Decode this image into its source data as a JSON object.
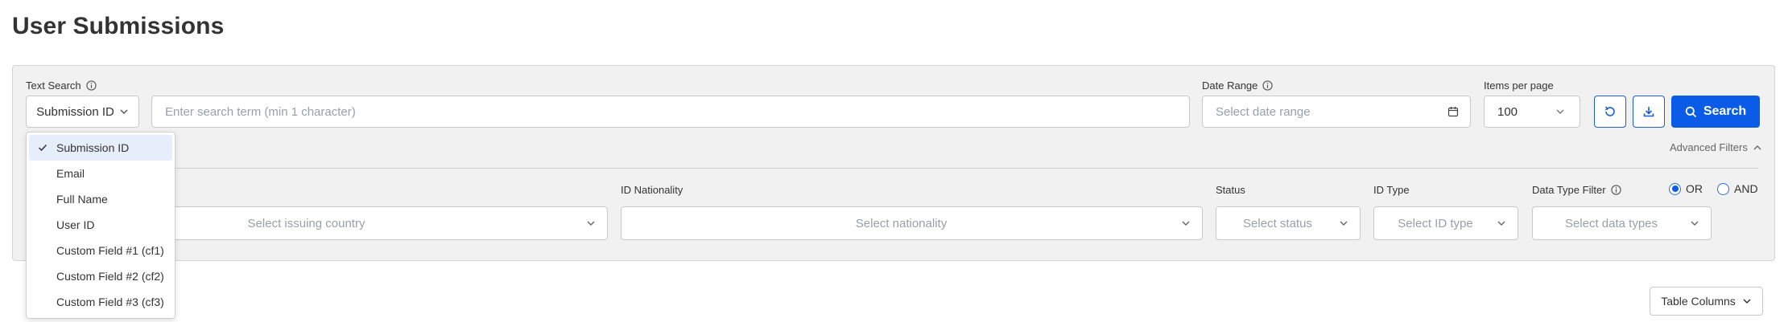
{
  "page": {
    "title": "User Submissions"
  },
  "filters": {
    "text_search_label": "Text Search",
    "search_type_value": "Submission ID",
    "search_placeholder": "Enter search term (min 1 character)",
    "date_range_label": "Date Range",
    "date_range_placeholder": "Select date range",
    "items_per_page_label": "Items per page",
    "items_per_page_value": "100",
    "search_button_label": "Search",
    "advanced_filters_label": "Advanced Filters",
    "issuing_country_placeholder": "Select issuing country",
    "id_nationality_label": "ID Nationality",
    "nationality_placeholder": "Select nationality",
    "status_label": "Status",
    "status_placeholder": "Select status",
    "id_type_label": "ID Type",
    "id_type_placeholder": "Select ID type",
    "data_type_filter_label": "Data Type Filter",
    "data_types_placeholder": "Select data types",
    "logic_options": [
      "OR",
      "AND"
    ],
    "logic_selected": "OR"
  },
  "search_type_dropdown": {
    "options": [
      "Submission ID",
      "Email",
      "Full Name",
      "User ID",
      "Custom Field #1 (cf1)",
      "Custom Field #2 (cf2)",
      "Custom Field #3 (cf3)"
    ],
    "selected": "Submission ID"
  },
  "table": {
    "columns_button_label": "Table Columns"
  },
  "colors": {
    "primary": "#0a5ce8",
    "panel_bg": "#f1f1f1",
    "selected_bg": "#e6eefc"
  },
  "icons": [
    "info-icon",
    "chevron-down-icon",
    "calendar-icon",
    "refresh-icon",
    "download-icon",
    "search-icon",
    "chevron-up-icon",
    "check-icon"
  ]
}
